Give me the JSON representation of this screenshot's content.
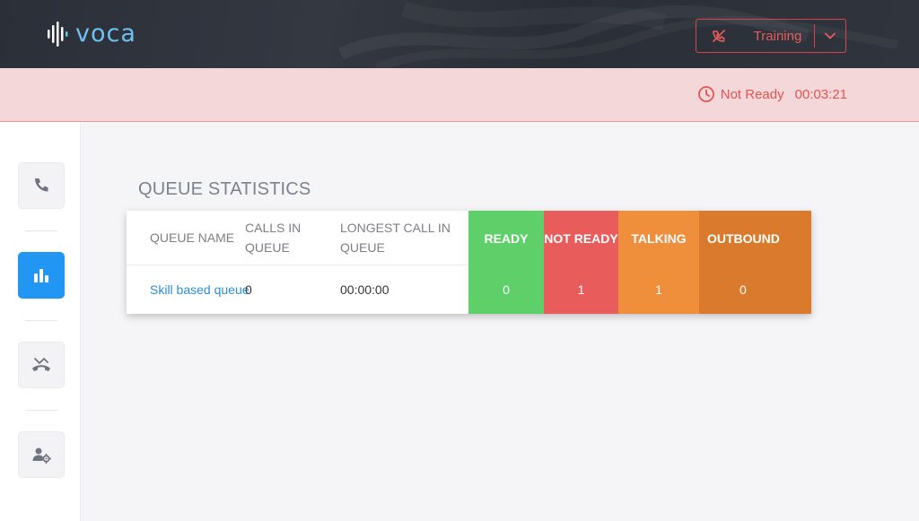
{
  "app": {
    "logo_text": "voca",
    "brand_color": "#6cc1f2"
  },
  "header": {
    "status_select": {
      "label": "Training",
      "icon": "phone-off-icon",
      "color": "#e45d5d"
    }
  },
  "status_bar": {
    "icon": "clock-icon",
    "state": "Not Ready",
    "timer": "00:03:21"
  },
  "sidebar": {
    "items": [
      {
        "name": "calls",
        "icon": "phone-icon",
        "active": false
      },
      {
        "name": "queue-statistics",
        "icon": "bar-chart-icon",
        "active": true
      },
      {
        "name": "missed-calls",
        "icon": "phone-hangup-icon",
        "active": false
      },
      {
        "name": "agent-settings",
        "icon": "user-gear-icon",
        "active": false
      }
    ],
    "active_color": "#2196f3"
  },
  "main": {
    "title": "QUEUE STATISTICS",
    "table": {
      "headers": {
        "queue_name": "QUEUE NAME",
        "calls_in_queue": "CALLS IN QUEUE",
        "longest_call": "LONGEST CALL IN QUEUE",
        "ready": "READY",
        "not_ready": "NOT READY",
        "talking": "TALKING",
        "outbound": "OUTBOUND"
      },
      "row": {
        "queue_name": "Skill based queue",
        "calls_in_queue": "0",
        "longest_call": "00:00:00",
        "ready": "0",
        "not_ready": "1",
        "talking": "1",
        "outbound": "0"
      },
      "colors": {
        "ready": "#5fcf6a",
        "not_ready": "#e85c5c",
        "talking": "#ef8f3b",
        "outbound": "#d97a2c"
      }
    }
  }
}
